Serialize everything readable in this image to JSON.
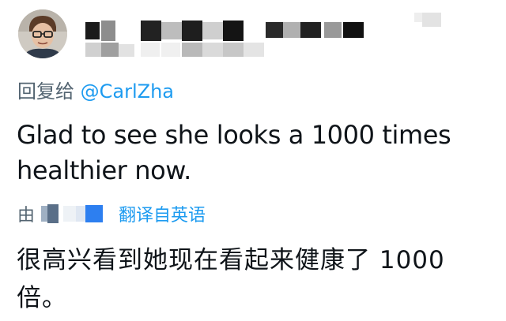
{
  "reply": {
    "prefix": "回复给",
    "handle": "@CarlZha"
  },
  "tweet": {
    "text": "Glad to see she looks a 1000 times healthier now."
  },
  "translation": {
    "by_label": "由",
    "link": "翻译自英语",
    "text": "很高兴看到她现在看起来健康了 1000 倍。"
  },
  "colors": {
    "accent": "#1d9bf0",
    "secondary_text": "#536471",
    "primary_text": "#0f1419"
  },
  "icons": {
    "avatar": "user-avatar",
    "translator_logo": "translator-logo-icon"
  }
}
